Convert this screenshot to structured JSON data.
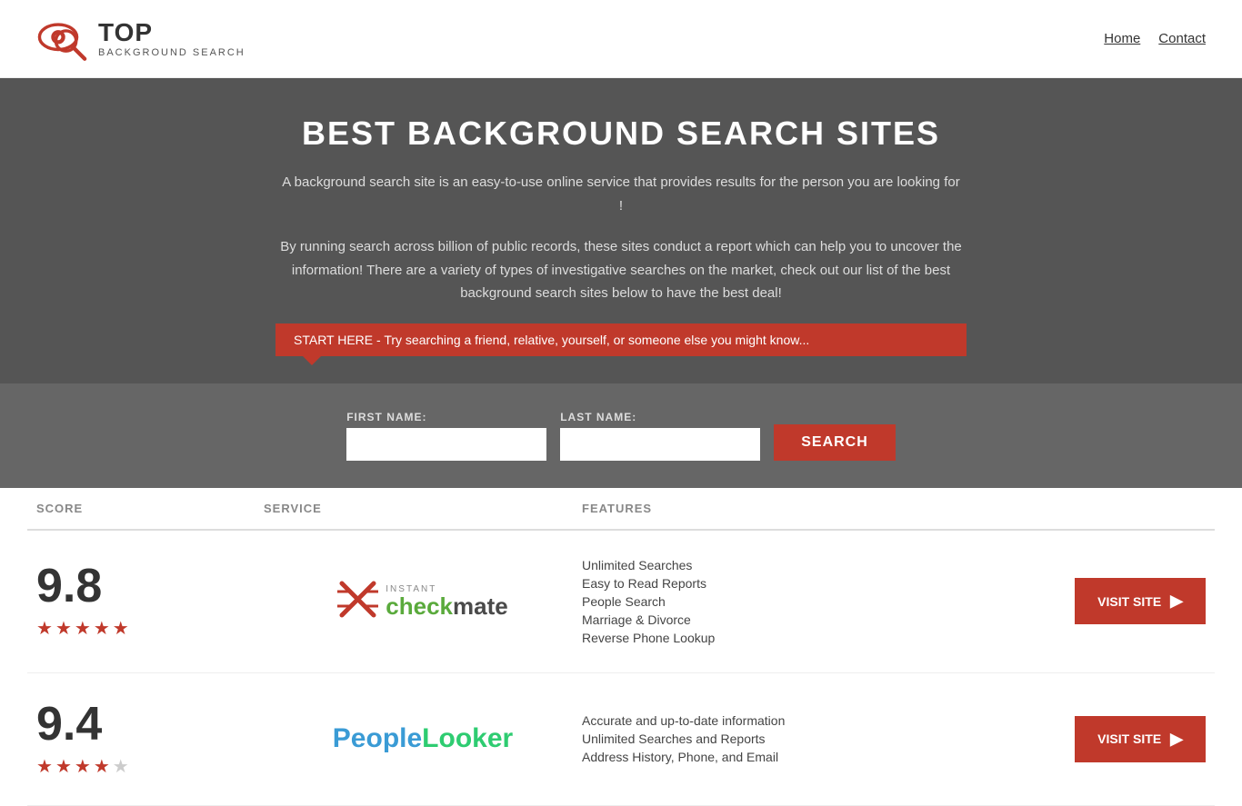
{
  "header": {
    "logo_top": "TOP",
    "logo_bottom": "BACKGROUND SEARCH",
    "nav": [
      {
        "label": "Home",
        "href": "#"
      },
      {
        "label": "Contact",
        "href": "#"
      }
    ]
  },
  "hero": {
    "title": "BEST BACKGROUND SEARCH SITES",
    "description1": "A background search site is an easy-to-use online service that provides results  for the person you are looking for !",
    "description2": "By  running  search across billion of public records, these sites conduct  a report which can help you to uncover the information! There are a variety of types of investigative searches on the market, check out our  list of the best background search sites below to have the best deal!",
    "search_banner": "START HERE - Try searching a friend, relative, yourself, or someone else you might know..."
  },
  "search_form": {
    "first_name_label": "FIRST NAME:",
    "last_name_label": "LAST NAME:",
    "button_label": "SEARCH",
    "first_name_placeholder": "",
    "last_name_placeholder": ""
  },
  "table": {
    "headers": [
      "SCORE",
      "SERVICE",
      "FEATURES"
    ],
    "rows": [
      {
        "score": "9.8",
        "stars": 4.5,
        "service_name": "Instant Checkmate",
        "service_label_top": "INSTANT",
        "service_label_bottom": "checkmate",
        "features": [
          "Unlimited Searches",
          "Easy to Read Reports",
          "People Search",
          "Marriage & Divorce",
          "Reverse Phone Lookup"
        ],
        "visit_label": "VISIT SITE"
      },
      {
        "score": "9.4",
        "stars": 4,
        "service_name": "PeopleLooker",
        "features": [
          "Accurate and up-to-date information",
          "Unlimited Searches and Reports",
          "Address History, Phone, and Email"
        ],
        "visit_label": "VISIT SITE"
      }
    ]
  }
}
